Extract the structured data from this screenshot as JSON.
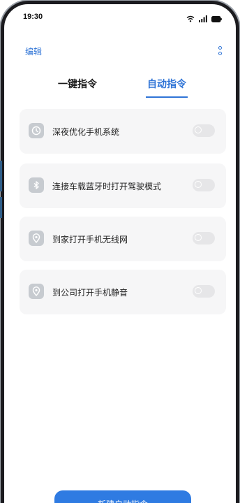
{
  "status_bar": {
    "time": "19:30",
    "icons": [
      "wifi-icon",
      "signal-icon",
      "battery-icon"
    ]
  },
  "nav": {
    "edit_label": "编辑",
    "more_icon": "more-vertical-icon"
  },
  "tabs": [
    {
      "label": "一键指令",
      "active": false
    },
    {
      "label": "自动指令",
      "active": true
    }
  ],
  "commands": [
    {
      "label": "深夜优化手机系统",
      "icon": "clock-icon",
      "enabled": false
    },
    {
      "label": "连接车载蓝牙时打开驾驶模式",
      "icon": "bluetooth-icon",
      "enabled": false
    },
    {
      "label": "到家打开手机无线网",
      "icon": "location-pin-icon",
      "enabled": false
    },
    {
      "label": "到公司打开手机静音",
      "icon": "location-pin-icon",
      "enabled": false
    }
  ],
  "new_button": {
    "label": "新建自动指令"
  },
  "colors": {
    "accent": "#2f74d6",
    "button": "#2f7be2",
    "card_bg": "#f6f6f7",
    "icon_bg": "#c7cbd0",
    "toggle_off": "#e6e6e8"
  }
}
